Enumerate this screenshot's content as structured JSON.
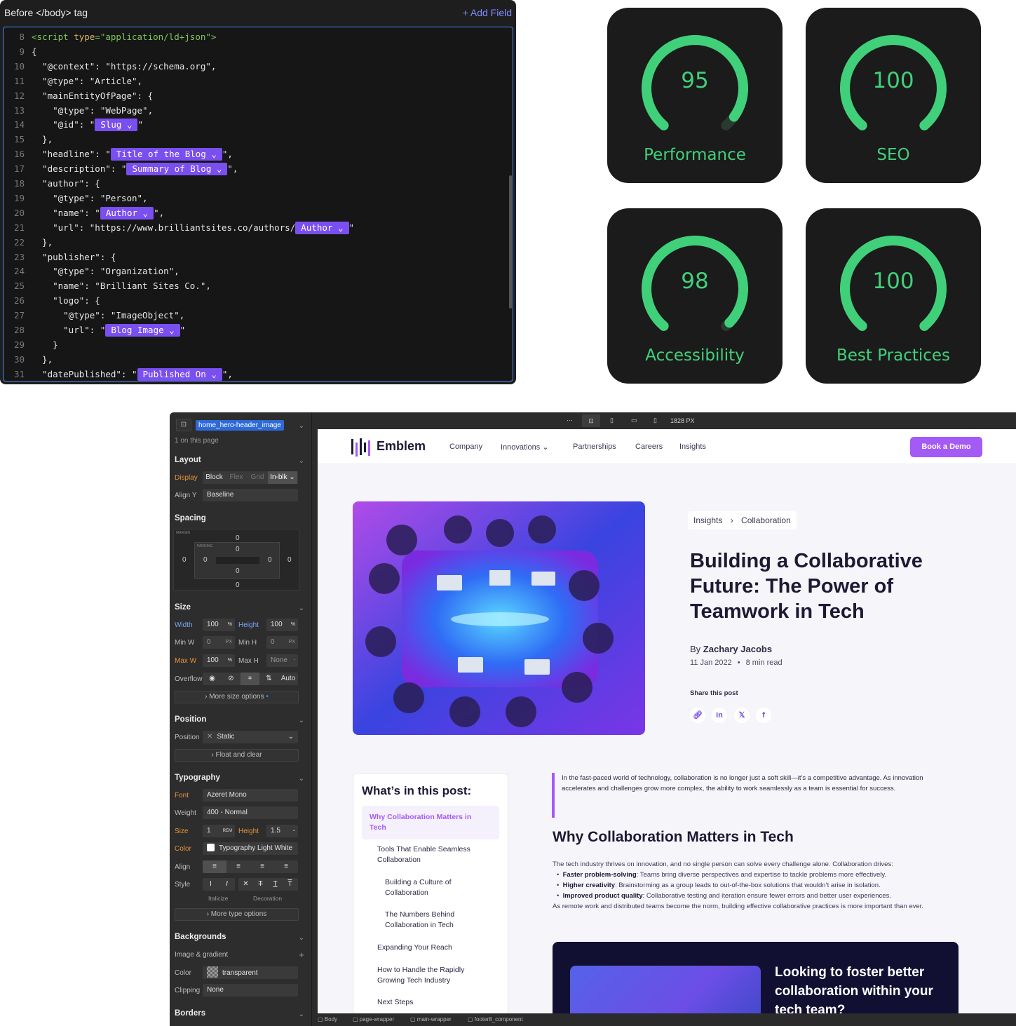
{
  "editor": {
    "title": "Before </body> tag",
    "add_field": "+ Add Field",
    "lines": [
      {
        "n": "8",
        "parts": [
          {
            "t": "<script ",
            "c": "tag"
          },
          {
            "t": "type",
            "c": "attr"
          },
          {
            "t": "=\"application/ld+json\">",
            "c": "tag"
          }
        ]
      },
      {
        "n": "9",
        "parts": [
          {
            "t": "{"
          }
        ]
      },
      {
        "n": "10",
        "parts": [
          {
            "t": "  \"@context\": \"https://schema.org\","
          }
        ]
      },
      {
        "n": "11",
        "parts": [
          {
            "t": "  \"@type\": \"Article\","
          }
        ]
      },
      {
        "n": "12",
        "parts": [
          {
            "t": "  \"mainEntityOfPage\": {"
          }
        ]
      },
      {
        "n": "13",
        "parts": [
          {
            "t": "    \"@type\": \"WebPage\","
          }
        ]
      },
      {
        "n": "14",
        "parts": [
          {
            "t": "    \"@id\": \""
          },
          {
            "chip": "Slug ⌄"
          },
          {
            "t": "\""
          }
        ]
      },
      {
        "n": "15",
        "parts": [
          {
            "t": "  },"
          }
        ]
      },
      {
        "n": "16",
        "parts": [
          {
            "t": "  \"headline\": \""
          },
          {
            "chip": "Title of the Blog ⌄"
          },
          {
            "t": "\","
          }
        ]
      },
      {
        "n": "17",
        "parts": [
          {
            "t": "  \"description\": \""
          },
          {
            "chip": "Summary of Blog ⌄"
          },
          {
            "t": "\","
          }
        ]
      },
      {
        "n": "18",
        "parts": [
          {
            "t": "  \"author\": {"
          }
        ]
      },
      {
        "n": "19",
        "parts": [
          {
            "t": "    \"@type\": \"Person\","
          }
        ]
      },
      {
        "n": "20",
        "parts": [
          {
            "t": "    \"name\": \""
          },
          {
            "chip": "Author ⌄"
          },
          {
            "t": "\","
          }
        ]
      },
      {
        "n": "21",
        "parts": [
          {
            "t": "    \"url\": \"https://www.brilliantsites.co/authors/"
          },
          {
            "chip": "Author ⌄"
          },
          {
            "t": "\""
          }
        ]
      },
      {
        "n": "22",
        "parts": [
          {
            "t": "  },"
          }
        ]
      },
      {
        "n": "23",
        "parts": [
          {
            "t": "  \"publisher\": {"
          }
        ]
      },
      {
        "n": "24",
        "parts": [
          {
            "t": "    \"@type\": \"Organization\","
          }
        ]
      },
      {
        "n": "25",
        "parts": [
          {
            "t": "    \"name\": \"Brilliant Sites Co.\","
          }
        ]
      },
      {
        "n": "26",
        "parts": [
          {
            "t": "    \"logo\": {"
          }
        ]
      },
      {
        "n": "27",
        "parts": [
          {
            "t": "      \"@type\": \"ImageObject\","
          }
        ]
      },
      {
        "n": "28",
        "parts": [
          {
            "t": "      \"url\": \""
          },
          {
            "chip": "Blog Image ⌄"
          },
          {
            "t": "\""
          }
        ]
      },
      {
        "n": "29",
        "parts": [
          {
            "t": "    }"
          }
        ]
      },
      {
        "n": "30",
        "parts": [
          {
            "t": "  },"
          }
        ]
      },
      {
        "n": "31",
        "parts": [
          {
            "t": "  \"datePublished\": \""
          },
          {
            "chip": "Published On ⌄"
          },
          {
            "t": "\","
          }
        ]
      }
    ]
  },
  "scores": [
    {
      "value": "95",
      "label": "Performance",
      "fraction": 0.95
    },
    {
      "value": "100",
      "label": "SEO",
      "fraction": 1.0
    },
    {
      "value": "98",
      "label": "Accessibility",
      "fraction": 0.98
    },
    {
      "value": "100",
      "label": "Best Practices",
      "fraction": 1.0
    }
  ],
  "colors": {
    "score_green": "#41d07a",
    "accent": "#a45af5",
    "chip": "#7a4ff0"
  },
  "designer": {
    "selected_class": "home_hero-header_image",
    "on_page": "1 on this page",
    "layout": {
      "title": "Layout",
      "display_label": "Display",
      "display_opts": [
        "Block",
        "Flex",
        "Grid",
        "In-blk ⌄"
      ],
      "align_label": "Align Y",
      "align_value": "Baseline"
    },
    "spacing": {
      "title": "Spacing",
      "margin_label": "MARGIN",
      "padding_label": "PADDING",
      "values": {
        "mt": "0",
        "ml": "0",
        "mr": "0",
        "mb": "0",
        "pt": "0",
        "pl": "0",
        "pr": "0",
        "pb": "0"
      }
    },
    "size": {
      "title": "Size",
      "width_label": "Width",
      "width_val": "100",
      "width_unit": "%",
      "height_label": "Height",
      "height_val": "100",
      "height_unit": "%",
      "minw_label": "Min W",
      "minw_val": "0",
      "minw_unit": "PX",
      "minh_label": "Min H",
      "minh_val": "0",
      "minh_unit": "PX",
      "maxw_label": "Max W",
      "maxw_val": "100",
      "maxw_unit": "%",
      "maxh_label": "Max H",
      "maxh_val": "None",
      "maxh_unit": "-",
      "overflow_label": "Overflow",
      "overflow_auto": "Auto",
      "more": "More size options"
    },
    "position": {
      "title": "Position",
      "label": "Position",
      "value": "Static",
      "float": "Float and clear"
    },
    "typography": {
      "title": "Typography",
      "font_label": "Font",
      "font_value": "Azeret Mono",
      "weight_label": "Weight",
      "weight_value": "400 - Normal",
      "size_label": "Size",
      "size_value": "1",
      "size_unit": "REM",
      "lh_label": "Height",
      "lh_value": "1.5",
      "lh_unit": "-",
      "color_label": "Color",
      "color_value": "Typography Light White",
      "align_label": "Align",
      "style_label": "Style",
      "italicize": "Italicize",
      "decoration": "Decoration",
      "more": "More type options"
    },
    "backgrounds": {
      "title": "Backgrounds",
      "image_label": "Image & gradient",
      "color_label": "Color",
      "color_value": "transparent",
      "clip_label": "Clipping",
      "clip_value": "None"
    },
    "borders": {
      "title": "Borders"
    },
    "topbar": {
      "dots": "···",
      "width_text": "1828 PX"
    },
    "breadcrumbs": [
      "Body",
      "page-wrapper",
      "main-wrapper",
      "footer8_component"
    ]
  },
  "site": {
    "logo": "Emblem",
    "nav": [
      "Company",
      "Innovations",
      "Partnerships",
      "Careers",
      "Insights"
    ],
    "cta_button": "Book a Demo",
    "crumb": [
      "Insights",
      "Collaboration"
    ],
    "title": "Building a Collaborative Future: The Power of Teamwork in Tech",
    "by_prefix": "By ",
    "author": "Zachary Jacobs",
    "date": "11 Jan 2022",
    "read_time": "8 min read",
    "share_label": "Share this post",
    "toc_title": "What’s in this post:",
    "toc": [
      "Why Collaboration Matters in Tech",
      "Tools That Enable Seamless Collaboration",
      "Building a Culture of Collaboration",
      "The Numbers Behind Collaboration in Tech",
      "Expanding Your Reach",
      "How to Handle the Rapidly Growing Tech Industry",
      "Next Steps"
    ],
    "quote": "In the fast-paced world of technology, collaboration is no longer just a soft skill—it’s a competitive advantage. As innovation accelerates and challenges grow more complex, the ability to work seamlessly as a team is essential for success.",
    "h2": "Why Collaboration Matters in Tech",
    "intro": "The tech industry thrives on innovation, and no single person can solve every challenge alone. Collaboration drives:",
    "bullets": [
      {
        "b": "Faster problem-solving",
        "t": ": Teams bring diverse perspectives and expertise to tackle problems more effectively."
      },
      {
        "b": "Higher creativity",
        "t": ": Brainstorming as a group leads to out-of-the-box solutions that wouldn’t arise in isolation."
      },
      {
        "b": "Improved product quality",
        "t": ": Collaborative testing and iteration ensure fewer errors and better user experiences."
      }
    ],
    "outro": "As remote work and distributed teams become the norm, building effective collaborative practices is more important than ever.",
    "cta_heading": "Looking to foster better collaboration within your tech team?"
  }
}
